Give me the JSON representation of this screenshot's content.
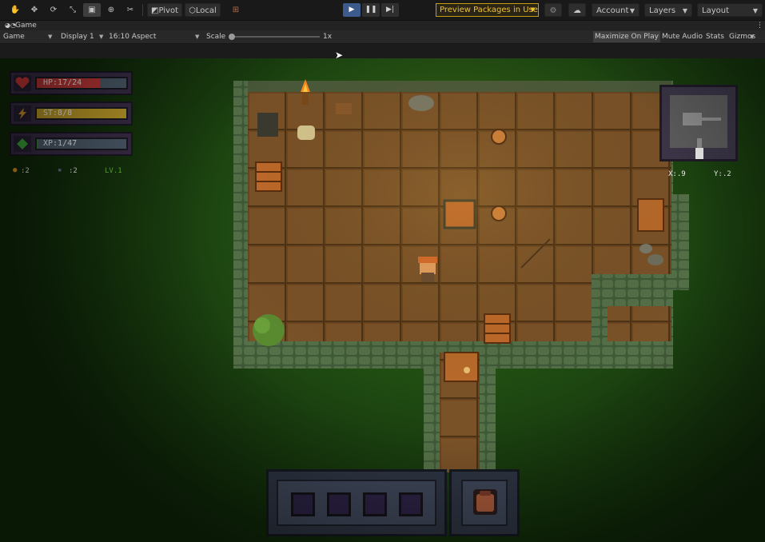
{
  "toolbar": {
    "pivot_label": "Pivot",
    "local_label": "Local",
    "preview_packages_label": "Preview Packages in Use",
    "account_label": "Account",
    "layers_label": "Layers",
    "layout_label": "Layout",
    "play_icon": "play-icon",
    "pause_icon": "pause-icon",
    "step_icon": "step-icon"
  },
  "game_tab": {
    "title": "Game",
    "view_select": "Game",
    "display_select": "Display 1",
    "aspect_select": "16:10 Aspect",
    "scale_label": "Scale",
    "scale_value": "1x",
    "maximize_label": "Maximize On Play",
    "mute_label": "Mute Audio",
    "stats_label": "Stats",
    "gizmos_label": "Gizmos"
  },
  "hud": {
    "hp_label": "HP:17/24",
    "hp_fraction": 0.708,
    "st_label": "ST:8/8",
    "st_fraction": 1.0,
    "xp_label": "XP:1/47",
    "xp_fraction": 0.021,
    "coins": ":2",
    "keys": ":2",
    "level": "LV.1",
    "coord_x": "X:.9",
    "coord_y": "Y:.2"
  },
  "colors": {
    "accent_preview": "#f0c233",
    "hp_fill": "#c83a3a",
    "st_fill": "#c8a42a",
    "xp_fill": "#3f8a3a"
  }
}
